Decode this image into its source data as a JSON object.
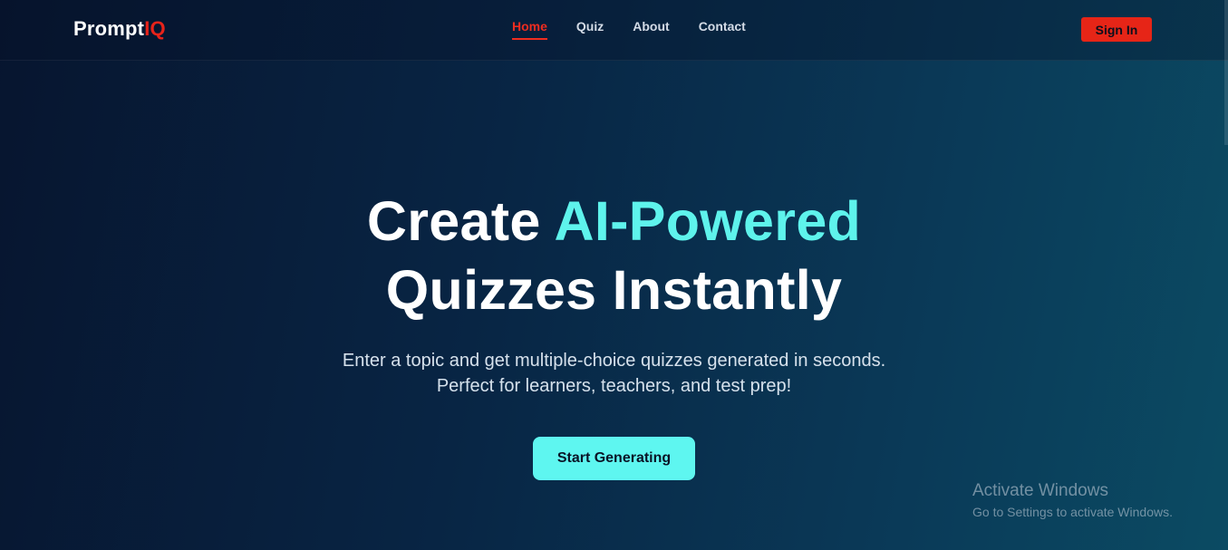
{
  "header": {
    "logo": {
      "main": "Prompt",
      "accent": "IQ"
    },
    "nav": [
      {
        "label": "Home",
        "active": true
      },
      {
        "label": "Quiz",
        "active": false
      },
      {
        "label": "About",
        "active": false
      },
      {
        "label": "Contact",
        "active": false
      }
    ],
    "signin_label": "Sign In"
  },
  "hero": {
    "title_part1": "Create ",
    "title_highlight": "AI-Powered",
    "title_line2": "Quizzes Instantly",
    "subtitle_line1": "Enter a topic and get multiple-choice quizzes generated in seconds.",
    "subtitle_line2": "Perfect for learners, teachers, and test prep!",
    "cta_label": "Start Generating"
  },
  "watermark": {
    "title": "Activate Windows",
    "subtitle": "Go to Settings to activate Windows."
  },
  "colors": {
    "accent_red": "#e8231a",
    "accent_cyan": "#5ef3ec",
    "background_dark": "#07152f",
    "background_teal": "#0b4b63"
  }
}
